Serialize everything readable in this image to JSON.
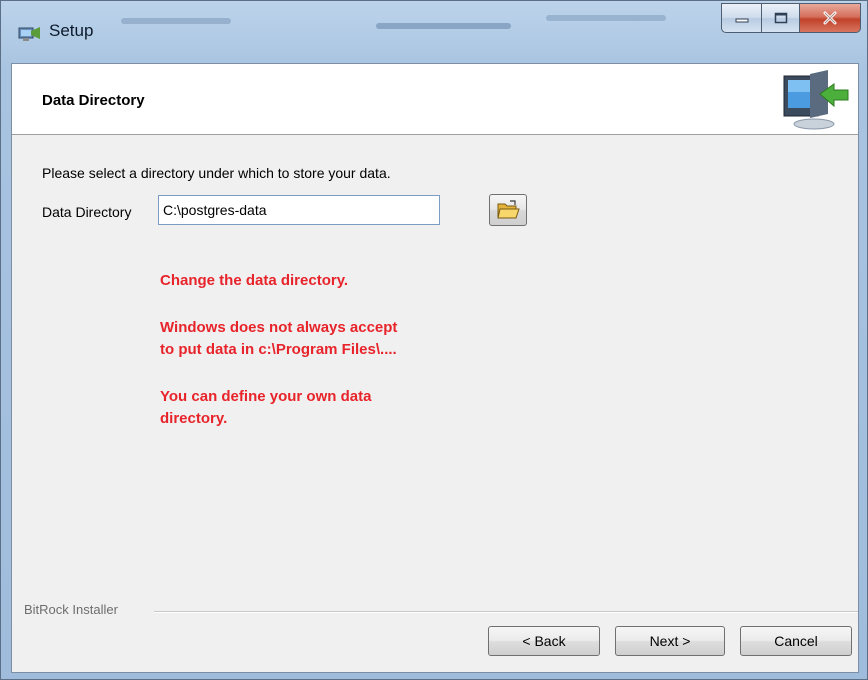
{
  "window": {
    "title": "Setup",
    "controls": {
      "minimize": "minimize-icon",
      "maximize": "maximize-icon",
      "close": "close-icon"
    }
  },
  "header": {
    "title": "Data Directory",
    "icon": "computer-arrow-icon"
  },
  "body": {
    "instruction": "Please select a directory under which to store your data.",
    "field_label": "Data Directory",
    "field_value": "C:\\postgres-data",
    "browse_icon": "folder-open-icon"
  },
  "annotations": {
    "line1": "Change the data directory.",
    "line2": "Windows does not always accept\nto put data in c:\\Program Files\\....",
    "line3": "You can define your own data\ndirectory.",
    "color": "#e8242b"
  },
  "footer": {
    "brand": "BitRock Installer",
    "back_label": "< Back",
    "next_label": "Next >",
    "cancel_label": "Cancel"
  }
}
